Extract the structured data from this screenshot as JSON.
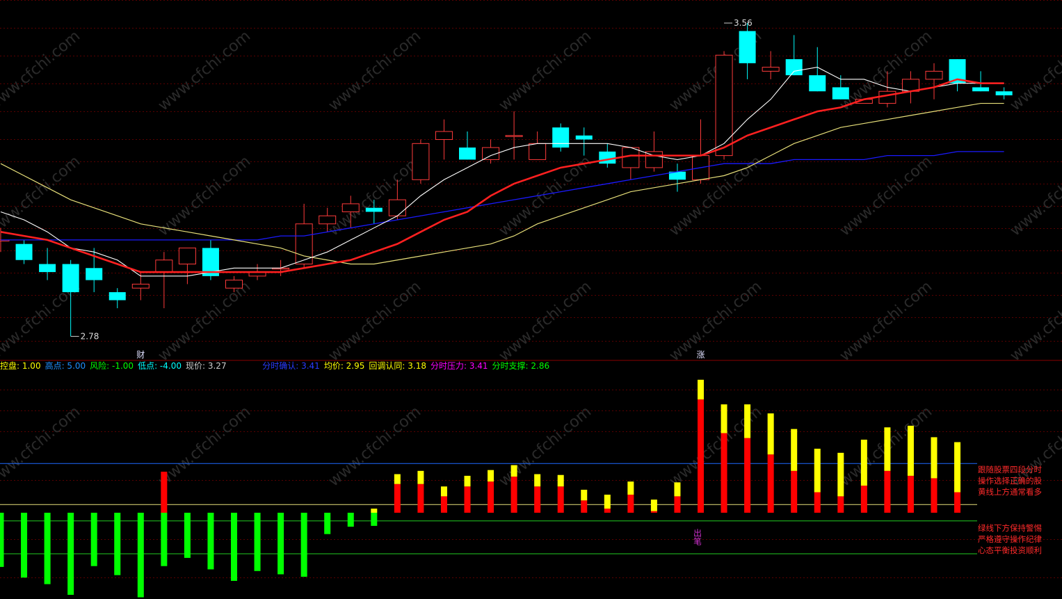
{
  "colors": {
    "background": "#000000",
    "grid": "#5a0000",
    "up": "#ff3b3b",
    "down": "#00ffff",
    "ma5": "#ffffff",
    "ma10": "#ff2020",
    "ma20": "#e8e07a",
    "ma60": "#1a1aff",
    "vol_red": "#ff0000",
    "vol_yellow": "#ffff00",
    "vol_green": "#00ff00",
    "blue_line": "#1e6bff",
    "yellow_line": "#e8e07a",
    "green_line": "#22cc22"
  },
  "info_row": {
    "left": [
      {
        "label": "控盘:",
        "value": "1.00",
        "color": "#ffff00"
      },
      {
        "label": "高点:",
        "value": "5.00",
        "color": "#1e90ff"
      },
      {
        "label": "风险:",
        "value": "-1.00",
        "color": "#00ff00"
      },
      {
        "label": "低点:",
        "value": "-4.00",
        "color": "#00ffff"
      },
      {
        "label": "现价:",
        "value": "3.27",
        "color": "#cccccc"
      }
    ],
    "right": [
      {
        "label": "分时确认:",
        "value": "3.41",
        "color": "#2a3cff"
      },
      {
        "label": "均价:",
        "value": "2.95",
        "color": "#ffff00"
      },
      {
        "label": "回调认同:",
        "value": "3.18",
        "color": "#ffff00"
      },
      {
        "label": "分时压力:",
        "value": "3.41",
        "color": "#ff00ff"
      },
      {
        "label": "分时支撑:",
        "value": "2.86",
        "color": "#00ff00"
      }
    ]
  },
  "notes": {
    "top": [
      "跟随股票四段分时",
      "操作选择正确的股",
      "黄线上方通常看多"
    ],
    "bottom": [
      "绿线下方保持警惕",
      "严格遵守操作纪律",
      "心态平衡投资顺利"
    ]
  },
  "markers": {
    "cai": "财",
    "zhang": "涨",
    "chubi": "出笔"
  },
  "chart_data": [
    {
      "type": "candlestick",
      "annotations": [
        {
          "text": "3.56",
          "x": 31,
          "y": 3.56
        },
        {
          "text": "2.78",
          "x": 3,
          "y": 2.78
        }
      ],
      "ylim": [
        2.76,
        3.6
      ],
      "candles": [
        {
          "o": 3.02,
          "c": 3.02,
          "h": 3.05,
          "l": 2.99
        },
        {
          "o": 3.01,
          "c": 2.97,
          "h": 3.02,
          "l": 2.96
        },
        {
          "o": 2.96,
          "c": 2.94,
          "h": 3.0,
          "l": 2.92
        },
        {
          "o": 2.96,
          "c": 2.89,
          "h": 2.97,
          "l": 2.78
        },
        {
          "o": 2.95,
          "c": 2.92,
          "h": 3.0,
          "l": 2.89
        },
        {
          "o": 2.89,
          "c": 2.87,
          "h": 2.9,
          "l": 2.85
        },
        {
          "o": 2.9,
          "c": 2.91,
          "h": 2.94,
          "l": 2.87
        },
        {
          "o": 2.94,
          "c": 2.97,
          "h": 2.99,
          "l": 2.85
        },
        {
          "o": 2.96,
          "c": 3.0,
          "h": 3.0,
          "l": 2.91
        },
        {
          "o": 3.0,
          "c": 2.93,
          "h": 3.02,
          "l": 2.92
        },
        {
          "o": 2.9,
          "c": 2.92,
          "h": 2.93,
          "l": 2.89
        },
        {
          "o": 2.93,
          "c": 2.94,
          "h": 2.96,
          "l": 2.92
        },
        {
          "o": 2.95,
          "c": 2.95,
          "h": 2.97,
          "l": 2.93
        },
        {
          "o": 2.96,
          "c": 3.06,
          "h": 3.11,
          "l": 2.95
        },
        {
          "o": 3.06,
          "c": 3.08,
          "h": 3.1,
          "l": 3.04
        },
        {
          "o": 3.09,
          "c": 3.11,
          "h": 3.13,
          "l": 3.05
        },
        {
          "o": 3.1,
          "c": 3.09,
          "h": 3.12,
          "l": 3.06
        },
        {
          "o": 3.08,
          "c": 3.12,
          "h": 3.17,
          "l": 3.07
        },
        {
          "o": 3.17,
          "c": 3.26,
          "h": 3.27,
          "l": 3.16
        },
        {
          "o": 3.27,
          "c": 3.29,
          "h": 3.32,
          "l": 3.22
        },
        {
          "o": 3.25,
          "c": 3.22,
          "h": 3.29,
          "l": 3.22
        },
        {
          "o": 3.22,
          "c": 3.25,
          "h": 3.27,
          "l": 3.21
        },
        {
          "o": 3.28,
          "c": 3.28,
          "h": 3.34,
          "l": 3.22
        },
        {
          "o": 3.22,
          "c": 3.26,
          "h": 3.29,
          "l": 3.22
        },
        {
          "o": 3.3,
          "c": 3.25,
          "h": 3.31,
          "l": 3.24
        },
        {
          "o": 3.28,
          "c": 3.27,
          "h": 3.3,
          "l": 3.23
        },
        {
          "o": 3.24,
          "c": 3.21,
          "h": 3.26,
          "l": 3.2
        },
        {
          "o": 3.2,
          "c": 3.25,
          "h": 3.24,
          "l": 3.17
        },
        {
          "o": 3.2,
          "c": 3.24,
          "h": 3.29,
          "l": 3.19
        },
        {
          "o": 3.19,
          "c": 3.17,
          "h": 3.21,
          "l": 3.14
        },
        {
          "o": 3.17,
          "c": 3.23,
          "h": 3.32,
          "l": 3.16
        },
        {
          "o": 3.23,
          "c": 3.48,
          "h": 3.49,
          "l": 3.22
        },
        {
          "o": 3.54,
          "c": 3.46,
          "h": 3.56,
          "l": 3.42
        },
        {
          "o": 3.44,
          "c": 3.45,
          "h": 3.49,
          "l": 3.42
        },
        {
          "o": 3.47,
          "c": 3.43,
          "h": 3.53,
          "l": 3.43
        },
        {
          "o": 3.43,
          "c": 3.39,
          "h": 3.5,
          "l": 3.39
        },
        {
          "o": 3.4,
          "c": 3.37,
          "h": 3.43,
          "l": 3.37
        },
        {
          "o": 3.36,
          "c": 3.37,
          "h": 3.37,
          "l": 3.36
        },
        {
          "o": 3.36,
          "c": 3.39,
          "h": 3.44,
          "l": 3.35
        },
        {
          "o": 3.39,
          "c": 3.42,
          "h": 3.44,
          "l": 3.36
        },
        {
          "o": 3.42,
          "c": 3.44,
          "h": 3.46,
          "l": 3.37
        },
        {
          "o": 3.47,
          "c": 3.41,
          "h": 3.47,
          "l": 3.39
        },
        {
          "o": 3.4,
          "c": 3.39,
          "h": 3.44,
          "l": 3.39
        },
        {
          "o": 3.39,
          "c": 3.38,
          "h": 3.4,
          "l": 3.37
        }
      ],
      "ma5": [
        3.09,
        3.07,
        3.04,
        3.0,
        2.99,
        2.97,
        2.93,
        2.93,
        2.93,
        2.94,
        2.95,
        2.95,
        2.95,
        2.97,
        2.99,
        3.02,
        3.05,
        3.08,
        3.13,
        3.17,
        3.2,
        3.23,
        3.25,
        3.26,
        3.26,
        3.26,
        3.26,
        3.25,
        3.23,
        3.22,
        3.23,
        3.26,
        3.32,
        3.37,
        3.44,
        3.45,
        3.42,
        3.42,
        3.4,
        3.39,
        3.4,
        3.41,
        3.41,
        3.41
      ],
      "ma10": [
        3.04,
        3.03,
        3.02,
        3.0,
        2.98,
        2.96,
        2.94,
        2.94,
        2.94,
        2.94,
        2.94,
        2.94,
        2.94,
        2.95,
        2.96,
        2.97,
        2.99,
        3.01,
        3.04,
        3.07,
        3.09,
        3.13,
        3.16,
        3.18,
        3.2,
        3.21,
        3.22,
        3.23,
        3.23,
        3.23,
        3.23,
        3.25,
        3.28,
        3.3,
        3.32,
        3.34,
        3.35,
        3.37,
        3.38,
        3.39,
        3.4,
        3.42,
        3.41,
        3.41
      ],
      "ma20": [
        3.21,
        3.18,
        3.15,
        3.12,
        3.1,
        3.08,
        3.06,
        3.05,
        3.04,
        3.03,
        3.02,
        3.01,
        3.0,
        2.98,
        2.97,
        2.96,
        2.96,
        2.97,
        2.98,
        2.99,
        3.0,
        3.01,
        3.03,
        3.06,
        3.08,
        3.1,
        3.12,
        3.14,
        3.15,
        3.16,
        3.17,
        3.18,
        3.2,
        3.23,
        3.26,
        3.28,
        3.3,
        3.31,
        3.32,
        3.33,
        3.34,
        3.35,
        3.36,
        3.36
      ],
      "ma60": [
        3.02,
        3.02,
        3.02,
        3.02,
        3.02,
        3.02,
        3.02,
        3.02,
        3.02,
        3.02,
        3.02,
        3.02,
        3.03,
        3.03,
        3.04,
        3.05,
        3.06,
        3.07,
        3.08,
        3.09,
        3.1,
        3.11,
        3.12,
        3.13,
        3.14,
        3.15,
        3.16,
        3.17,
        3.18,
        3.19,
        3.2,
        3.21,
        3.21,
        3.21,
        3.22,
        3.22,
        3.22,
        3.22,
        3.23,
        3.23,
        3.23,
        3.24,
        3.24,
        3.24
      ]
    },
    {
      "type": "bar",
      "reference_lines": [
        {
          "y": 6,
          "color": "blue"
        },
        {
          "y": 1,
          "color": "yellow"
        },
        {
          "y": -1,
          "color": "green"
        },
        {
          "y": -5,
          "color": "green"
        }
      ],
      "ylim": [
        -10.3,
        16.4
      ],
      "red": [
        -1,
        -1,
        -1,
        -1,
        -1,
        -1,
        -1,
        5,
        -1,
        -1,
        -1,
        -1,
        -1,
        -1,
        -1,
        -1,
        0,
        3.5,
        3.5,
        2,
        3.2,
        3.8,
        4.4,
        3.2,
        3.2,
        1.5,
        0.5,
        2.2,
        0.2,
        2,
        13.8,
        9.7,
        9.1,
        7.1,
        5.1,
        2.5,
        2,
        3.3,
        5.1,
        4.5,
        4.2,
        2.5
      ],
      "yellow_top": [
        null,
        null,
        null,
        null,
        null,
        null,
        null,
        null,
        null,
        null,
        null,
        null,
        null,
        null,
        null,
        null,
        0.5,
        4.7,
        5.1,
        3.2,
        4.5,
        5.2,
        5.8,
        4.7,
        4.6,
        2.8,
        2.2,
        3.8,
        1.6,
        3.7,
        16.2,
        13.2,
        13.2,
        12.1,
        10.2,
        7.8,
        7.3,
        8.9,
        10.4,
        10.6,
        9.2,
        8.6
      ],
      "green": [
        -6.6,
        -7.9,
        -8.7,
        -10,
        -6.5,
        -7.6,
        -10.3,
        -6.5,
        -5.5,
        -6.9,
        -8.3,
        -7.1,
        -7.5,
        -7.8,
        -2.6,
        -1.7,
        -1.6
      ]
    }
  ]
}
